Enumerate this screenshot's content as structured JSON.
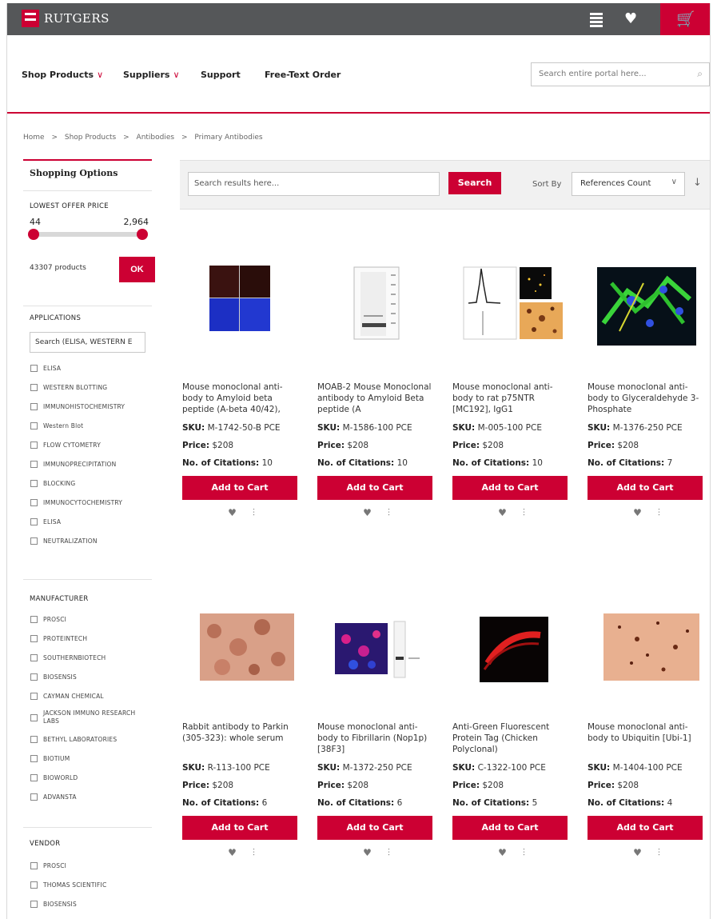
{
  "header": {
    "logo_text": "RUTGERS",
    "cart_icon": "shopping-cart-icon",
    "list_icon": "list-icon",
    "wishlist_icon": "heart-icon"
  },
  "nav": {
    "items": [
      "Shop Products",
      "Suppliers",
      "Support",
      "Free-Text Order"
    ],
    "search_placeholder": "Search entire portal here..."
  },
  "breadcrumb": [
    "Home",
    ">",
    "Shop Products",
    ">",
    "Antibodies",
    ">",
    "Primary Antibodies"
  ],
  "sidebar": {
    "title": "Shopping Options",
    "price": {
      "heading": "LOWEST OFFER PRICE",
      "min": "44",
      "max": "2,964",
      "count": "43307 products",
      "ok": "OK"
    },
    "applications": {
      "heading": "APPLICATIONS",
      "search_value": "Search (ELISA, WESTERN E",
      "items": [
        "ELISA",
        "WESTERN BLOTTING",
        "IMMUNOHISTOCHEMISTRY",
        "Western Blot",
        "FLOW CYTOMETRY",
        "IMMUNOPRECIPITATION",
        "BLOCKING",
        "IMMUNOCYTOCHEMISTRY",
        "ELISA",
        "NEUTRALIZATION"
      ]
    },
    "manufacturer": {
      "heading": "MANUFACTURER",
      "items": [
        "PROSCI",
        "PROTEINTECH",
        "SOUTHERNBIOTECH",
        "BIOSENSIS",
        "CAYMAN CHEMICAL",
        "JACKSON IMMUNO RESEARCH LABS",
        "BETHYL LABORATORIES",
        "BIOTIUM",
        "BIOWORLD",
        "ADVANSTA"
      ]
    },
    "vendor": {
      "heading": "VENDOR",
      "items": [
        "PROSCI",
        "THOMAS SCIENTIFIC",
        "BIOSENSIS"
      ]
    }
  },
  "toolbar": {
    "search_placeholder": "Search results here...",
    "search_btn": "Search",
    "sort_label": "Sort By",
    "sort_value": "References Count",
    "sort_direction": "↓"
  },
  "products": [
    {
      "name": "Mouse monoclonal anti-body to Amyloid beta peptide (A-beta 40/42),",
      "sku_label": "SKU:",
      "sku": "M-1742-50-B PCE",
      "price_label": "Price:",
      "price": "$208",
      "cit_label": "No. of Citations:",
      "citations": "10",
      "cart": "Add to Cart"
    },
    {
      "name": "MOAB-2 Mouse Monoclonal antibody to Amyloid Beta peptide (A",
      "sku_label": "SKU:",
      "sku": "M-1586-100 PCE",
      "price_label": "Price:",
      "price": "$208",
      "cit_label": "No. of Citations:",
      "citations": "10",
      "cart": "Add to Cart"
    },
    {
      "name": "Mouse monoclonal anti-body to rat p75NTR [MC192], IgG1",
      "sku_label": "SKU:",
      "sku": "M-005-100 PCE",
      "price_label": "Price:",
      "price": "$208",
      "cit_label": "No. of Citations:",
      "citations": "10",
      "cart": "Add to Cart"
    },
    {
      "name": "Mouse monoclonal anti-body to Glyceraldehyde 3-Phosphate",
      "sku_label": "SKU:",
      "sku": "M-1376-250 PCE",
      "price_label": "Price:",
      "price": "$208",
      "cit_label": "No. of Citations:",
      "citations": "7",
      "cart": "Add to Cart"
    },
    {
      "name": "Rabbit antibody to Parkin (305-323): whole serum",
      "sku_label": "SKU:",
      "sku": "R-113-100 PCE",
      "price_label": "Price:",
      "price": "$208",
      "cit_label": "No. of Citations:",
      "citations": "6",
      "cart": "Add to Cart"
    },
    {
      "name": "Mouse monoclonal anti-body to Fibrillarin (Nop1p) [38F3]",
      "sku_label": "SKU:",
      "sku": "M-1372-250 PCE",
      "price_label": "Price:",
      "price": "$208",
      "cit_label": "No. of Citations:",
      "citations": "6",
      "cart": "Add to Cart"
    },
    {
      "name": "Anti-Green Fluorescent Protein Tag (Chicken Polyclonal)",
      "sku_label": "SKU:",
      "sku": "C-1322-100 PCE",
      "price_label": "Price:",
      "price": "$208",
      "cit_label": "No. of Citations:",
      "citations": "5",
      "cart": "Add to Cart"
    },
    {
      "name": "Mouse monoclonal anti-body to Ubiquitin [Ubi-1]",
      "sku_label": "SKU:",
      "sku": "M-1404-100 PCE",
      "price_label": "Price:",
      "price": "$208",
      "cit_label": "No. of Citations:",
      "citations": "4",
      "cart": "Add to Cart"
    }
  ],
  "colors": {
    "accent": "#cc0033",
    "topbar": "#555759"
  }
}
